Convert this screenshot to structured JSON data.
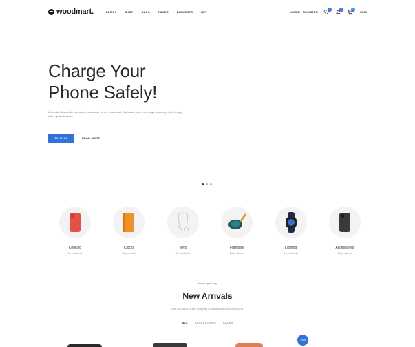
{
  "header": {
    "logo_text": "woodmart.",
    "nav": [
      "DEMOS",
      "SHOP",
      "BLOG",
      "PAGES",
      "ELEMENTS",
      "BUY"
    ],
    "login_label": "LOGIN / REGISTER",
    "wishlist_count": "0",
    "compare_count": "0",
    "cart_count": "0",
    "cart_total": "$0.00"
  },
  "hero": {
    "title": "Charge Your Phone Safely!",
    "text": "A wonderful serenity has taken possession of my entire soul, like these sweet mornings of spring which I enjoy with my whole heart.",
    "primary_button": "TO SHOP",
    "secondary_button": "READ MORE",
    "slides": 3,
    "active_slide": 1
  },
  "categories": [
    {
      "name": "Cooking",
      "count": "10 products",
      "icon": "red-phone-case-icon"
    },
    {
      "name": "Clocks",
      "count": "12 products",
      "icon": "orange-phone-case-icon"
    },
    {
      "name": "Toys",
      "count": "10 products",
      "icon": "earphones-icon"
    },
    {
      "name": "Furniture",
      "count": "20 products",
      "icon": "charging-pad-icon"
    },
    {
      "name": "Lighting",
      "count": "16 products",
      "icon": "smartwatch-icon"
    },
    {
      "name": "Accessories",
      "count": "10 products",
      "icon": "dark-phone-case-icon"
    }
  ],
  "new_arrivals": {
    "subtitle": "Hurry up to buy",
    "title": "New Arrivals",
    "description": "Visit our shop to see amazing creations from our designers.",
    "tabs": [
      "ALL",
      "ACCESSORIES",
      "CASES"
    ],
    "active_tab": "ALL",
    "badge": "-20%"
  },
  "colors": {
    "accent": "#3372d6",
    "hero_bg": "#f0f0f0"
  }
}
